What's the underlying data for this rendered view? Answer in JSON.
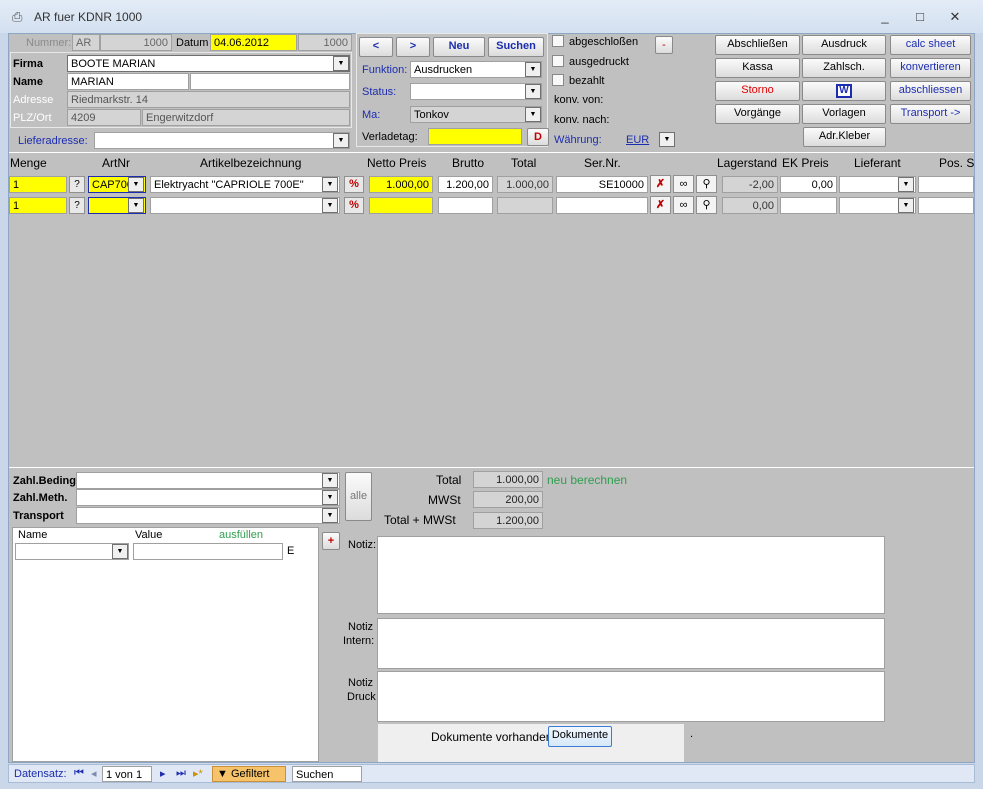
{
  "window": {
    "title": "AR fuer KDNR 1000",
    "minimize": "_",
    "maximize": "□",
    "close": "✕"
  },
  "header": {
    "nummer_label": "Nummer:",
    "nummer_prefix": "AR",
    "nummer_value": "1000",
    "datum_label": "Datum",
    "datum_value": "04.06.2012",
    "datum_extra": "1000",
    "firma_label": "Firma",
    "firma_value": "BOOTE MARIAN",
    "name_label": "Name",
    "name_value": "MARIAN",
    "name2_value": "",
    "adresse_label": "Adresse",
    "adresse_value": "Riedmarkstr. 14",
    "plz_label": "PLZ/Ort",
    "plz_value": "4209",
    "ort_value": "Engerwitzdorf",
    "lieferadresse_label": "Lieferadresse:",
    "lieferadresse_value": ""
  },
  "nav": {
    "prev": "<",
    "next": ">",
    "neu": "Neu",
    "suchen": "Suchen"
  },
  "funktion": {
    "funktion_label": "Funktion:",
    "funktion_value": "Ausdrucken",
    "status_label": "Status:",
    "status_value": "",
    "ma_label": "Ma:",
    "ma_value": "Tonkov",
    "verladetag_label": "Verladetag:",
    "verladetag_value": "",
    "d_button": "D"
  },
  "flags": {
    "abgeschlossen": "abgeschloßen",
    "ausgedruckt": "ausgedruckt",
    "bezahlt": "bezahlt",
    "konv_von": "konv. von:",
    "konv_nach": "konv. nach:",
    "waehrung_label": "Währung:",
    "waehrung_value": "EUR",
    "minus": "-"
  },
  "actions": {
    "abschliessen": "Abschließen",
    "ausdruck": "Ausdruck",
    "calc_sheet": "calc sheet",
    "kassa": "Kassa",
    "zahlsch": "Zahlsch.",
    "konvertieren": "konvertieren",
    "storno": "Storno",
    "word": "W",
    "abschliessen2": "abschliessen",
    "vorgaenge": "Vorgänge",
    "vorlagen": "Vorlagen",
    "transport": "Transport ->",
    "adr_kleber": "Adr.Kleber"
  },
  "columns": [
    "Menge",
    "ArtNr",
    "Artikelbezeichnung",
    "Netto Preis",
    "Brutto",
    "Total",
    "Ser.Nr.",
    "Lagerstand",
    "EK Preis",
    "Lieferant",
    "Pos. S"
  ],
  "rows": [
    {
      "menge": "1",
      "artnr": "CAP700",
      "bez": "Elektryacht \"CAPRIOLE 700E\"",
      "netto": "1.000,00",
      "brutto": "1.200,00",
      "total": "1.000,00",
      "sernr": "SE10000",
      "lager": "-2,00",
      "ek": "0,00",
      "lieferant": ""
    },
    {
      "menge": "1",
      "artnr": "",
      "bez": "",
      "netto": "",
      "brutto": "",
      "total": "",
      "sernr": "",
      "lager": "0,00",
      "ek": "",
      "lieferant": ""
    }
  ],
  "footer": {
    "zahl_beding": "Zahl.Beding.",
    "zahl_meth": "Zahl.Meth.",
    "transport": "Transport",
    "alle": "alle",
    "total_label": "Total",
    "total_value": "1.000,00",
    "neu_berechnen": "neu berechnen",
    "mwst_label": "MWSt",
    "mwst_value": "200,00",
    "total_mwst_label": "Total + MWSt",
    "total_mwst_value": "1.200,00",
    "name_col": "Name",
    "value_col": "Value",
    "ausfuellen": "ausfüllen",
    "e_label": "E",
    "plus": "+",
    "notiz": "Notiz:",
    "notiz_intern_1": "Notiz",
    "notiz_intern_2": "Intern:",
    "notiz_druck_1": "Notiz",
    "notiz_druck_2": "Druck",
    "dokumente_vorhanden": "Dokumente vorhanden",
    "dokumente_btn": "Dokumente",
    "dot": "."
  },
  "statusbar": {
    "datensatz": "Datensatz:",
    "record": "1 von 1",
    "gefiltert": "Gefiltert",
    "suchen": "Suchen"
  }
}
